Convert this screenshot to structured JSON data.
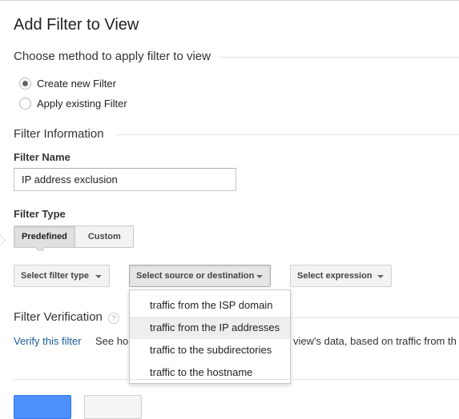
{
  "page_title": "Add Filter to View",
  "method_section": {
    "title": "Choose method to apply filter to view",
    "options": [
      {
        "label": "Create new Filter",
        "selected": true
      },
      {
        "label": "Apply existing Filter",
        "selected": false
      }
    ]
  },
  "filter_info": {
    "title": "Filter Information",
    "name_label": "Filter Name",
    "name_value": "IP address exclusion",
    "type_label": "Filter Type",
    "type_tabs": [
      "Predefined",
      "Custom"
    ],
    "active_type_tab": "Predefined",
    "selects": {
      "filter_type": "Select filter type",
      "source_destination": "Select source or destination",
      "expression": "Select expression"
    },
    "dropdown_options": [
      "traffic from the ISP domain",
      "traffic from the IP addresses",
      "traffic to the subdirectories",
      "traffic to the hostname"
    ],
    "highlighted_option": "traffic from the IP addresses"
  },
  "verification": {
    "title": "Filter Verification",
    "help_icon": "?",
    "link": "Verify this filter",
    "text_start": "See ho",
    "text_end": "view's data, based on traffic from th"
  },
  "colors": {
    "link": "#1a5c9c",
    "primary_button": "#4d90fe"
  }
}
